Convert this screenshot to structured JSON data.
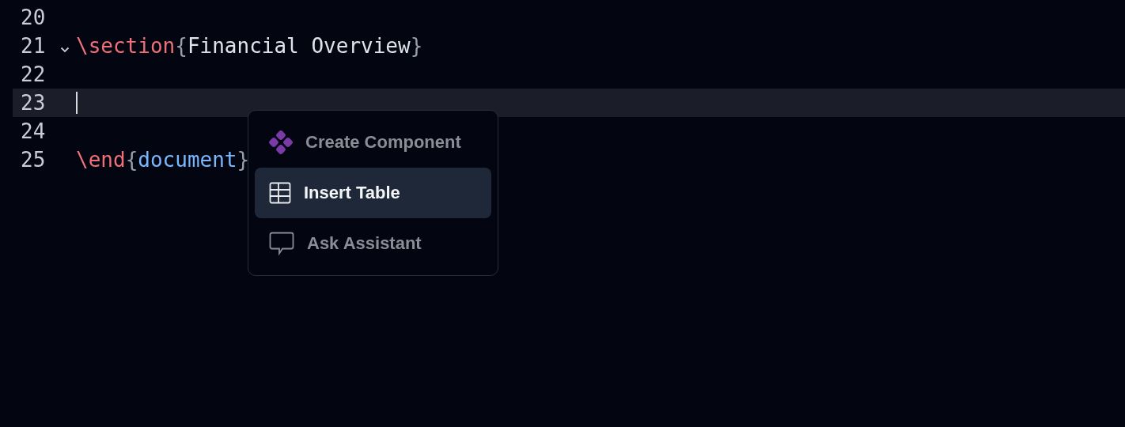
{
  "editor": {
    "lines": [
      {
        "number": "20",
        "foldable": false,
        "current": false
      },
      {
        "number": "21",
        "foldable": true,
        "current": false,
        "tokens": [
          {
            "kind": "command",
            "text": "\\section"
          },
          {
            "kind": "brace",
            "text": "{"
          },
          {
            "kind": "text",
            "text": "Financial Overview"
          },
          {
            "kind": "brace",
            "text": "}"
          }
        ]
      },
      {
        "number": "22",
        "foldable": false,
        "current": false
      },
      {
        "number": "23",
        "foldable": false,
        "current": true
      },
      {
        "number": "24",
        "foldable": false,
        "current": false
      },
      {
        "number": "25",
        "foldable": false,
        "current": false,
        "tokens": [
          {
            "kind": "command",
            "text": "\\end"
          },
          {
            "kind": "brace",
            "text": "{"
          },
          {
            "kind": "argument",
            "text": "document"
          },
          {
            "kind": "brace",
            "text": "}"
          }
        ]
      }
    ]
  },
  "menu": {
    "items": [
      {
        "kind": "component",
        "label": "Create Component",
        "selected": false
      },
      {
        "kind": "table",
        "label": "Insert Table",
        "selected": true
      },
      {
        "kind": "assistant",
        "label": "Ask Assistant",
        "selected": false
      }
    ]
  }
}
